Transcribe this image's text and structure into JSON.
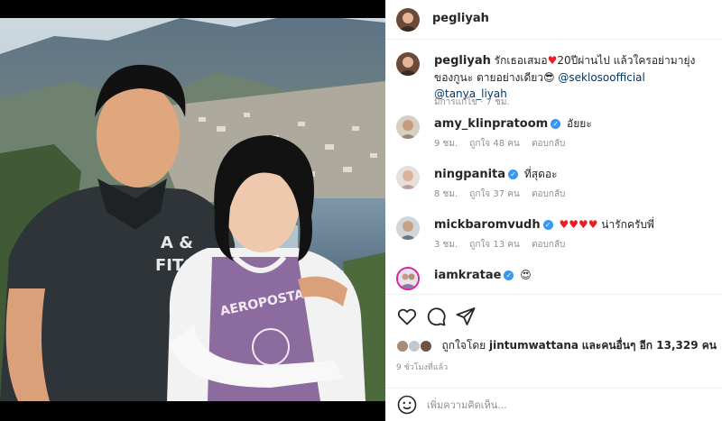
{
  "post": {
    "username": "pegliyah",
    "caption_user": "pegliyah",
    "caption_text_1": "รักเธอเสมอ",
    "caption_text_2": "20ปีผ่านไป แล้วใครอย่ามายุ่งของกูนะ",
    "caption_text_3": "ตายอย่างเดียว",
    "caption_mention_1": "@seklosoofficial",
    "caption_mention_2": "@tanya_liyah",
    "caption_meta": "มีการแก้ไข · 7 ชม."
  },
  "comments": [
    {
      "user": "amy_klinpratoom",
      "text": "อัยยะ",
      "time": "9 ชม.",
      "likes": "ถูกใจ 48 คน",
      "reply": "ตอบกลับ",
      "verified": true
    },
    {
      "user": "ningpanita",
      "text": "ที่สุดอะ",
      "time": "8 ชม.",
      "likes": "ถูกใจ 37 คน",
      "reply": "ตอบกลับ",
      "verified": true
    },
    {
      "user": "mickbaromvudh",
      "text": "น่ารักครับพี่",
      "time": "3 ชม.",
      "likes": "ถูกใจ 13 คน",
      "reply": "ตอบกลับ",
      "verified": true
    },
    {
      "user": "iamkratae",
      "text": "",
      "time": "",
      "likes": "",
      "reply": "",
      "verified": true
    }
  ],
  "actions": {
    "liked_by_prefix": "ถูกใจโดย",
    "liked_by_user": "jintumwattana",
    "liked_by_suffix": "และคนอื่นๆ อีก 13,329 คน",
    "timestamp": "9 ชั่วโมงที่แล้ว",
    "add_comment_placeholder": "เพิ่มความคิดเห็น..."
  },
  "icons": {
    "like": "heart-outline-icon",
    "comment": "comment-bubble-icon",
    "share": "paper-plane-icon",
    "emoji": "smiley-icon",
    "verified": "verified-badge-icon"
  },
  "colors": {
    "verified_blue": "#3897f0",
    "mention_blue": "#00376b",
    "heart_red": "#ed1c24",
    "muted_gray": "#8e8e8e"
  }
}
